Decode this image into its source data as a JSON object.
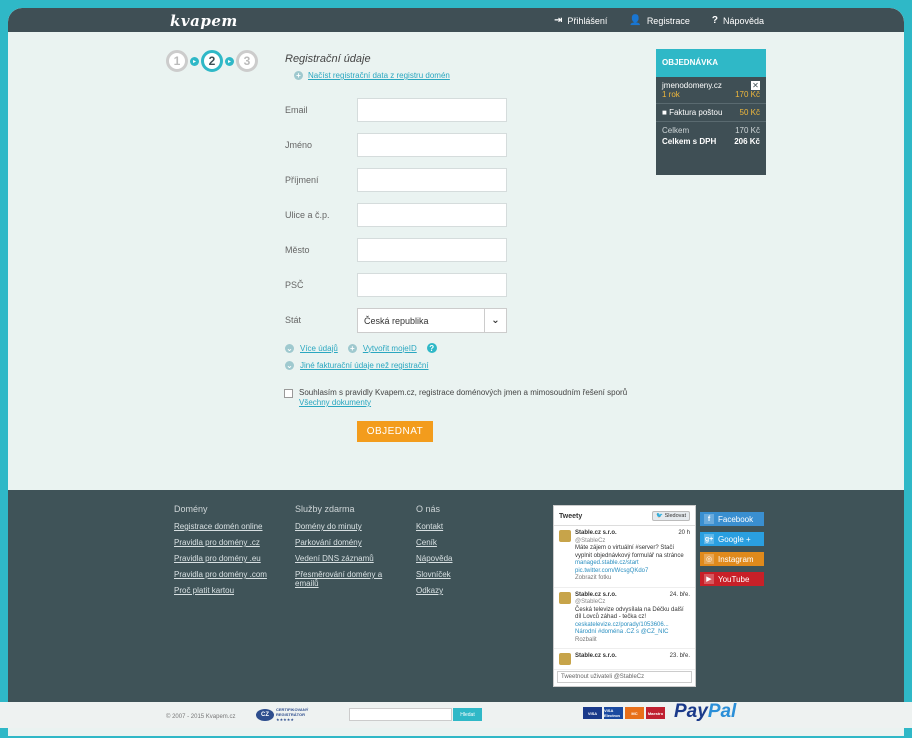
{
  "header": {
    "logo": "kvapem",
    "nav": [
      {
        "icon": "login-icon",
        "glyph": "⇥",
        "label": "Přihlášení"
      },
      {
        "icon": "user-add-icon",
        "glyph": "👤",
        "label": "Registrace"
      },
      {
        "icon": "help-icon",
        "glyph": "?",
        "label": "Nápověda"
      }
    ]
  },
  "steps": [
    "1",
    "2",
    "3"
  ],
  "active_step": 2,
  "form": {
    "title": "Registrační údaje",
    "load_link": "Načíst registrační data z registru domén",
    "fields": [
      {
        "label": "Email",
        "value": ""
      },
      {
        "label": "Jméno",
        "value": ""
      },
      {
        "label": "Příjmení",
        "value": ""
      },
      {
        "label": "Ulice a č.p.",
        "value": ""
      },
      {
        "label": "Město",
        "value": ""
      },
      {
        "label": "PSČ",
        "value": ""
      }
    ],
    "country_label": "Stát",
    "country_value": "Česká republika",
    "more_info": "Více údajů",
    "create_mojeid": "Vytvořit mojeID",
    "different_billing": "Jiné fakturační údaje než registrační",
    "agree_text": "Souhlasím s pravidly Kvapem.cz, registrace doménových jmen a mimosoudním řešení sporů",
    "all_docs": "Všechny dokumenty",
    "submit": "OBJEDNAT"
  },
  "order": {
    "title": "OBJEDNÁVKA",
    "domain": "jmenodomeny.cz",
    "period": "1 rok",
    "period_price": "170 Kč",
    "invoice_label": "Faktura poštou",
    "invoice_price": "50 Kč",
    "total_label": "Celkem",
    "total_value": "170 Kč",
    "total_vat_label": "Celkem s DPH",
    "total_vat_value": "206 Kč"
  },
  "footer": {
    "columns": [
      {
        "heading": "Domény",
        "links": [
          "Registrace domén online",
          "Pravidla pro domény .cz",
          "Pravidla pro domény .eu",
          "Pravidla pro domény .com",
          "Proč platit kartou"
        ]
      },
      {
        "heading": "Služby zdarma",
        "links": [
          "Domény do minuty",
          "Parkování domény",
          "Vedení DNS záznamů",
          "Přesměrování domény a emailů"
        ]
      },
      {
        "heading": "O nás",
        "links": [
          "Kontakt",
          "Ceník",
          "Nápověda",
          "Slovníček",
          "Odkazy"
        ]
      }
    ],
    "tweets": {
      "title": "Tweety",
      "follow": "Sledovat",
      "items": [
        {
          "author": "Stable.cz s.r.o.",
          "handle": "@StableCz",
          "time": "20 h",
          "text": "Máte zájem o virtuální #server? Stačí vyplnit objednávkový formulář na stránce",
          "link": "managed.stable.cz/start pic.twitter.com/WcsgQKdo7",
          "extra": "Zobrazit fotku"
        },
        {
          "author": "Stable.cz s.r.o.",
          "handle": "@StableCz",
          "time": "24. bře.",
          "text": "Česká televize odvysílala na Déčku další díl Lovců záhad - tečka cz!",
          "link": "ceskatelevize.cz/porady/1053606... Národní #doména .CZ s @CZ_NIC",
          "extra": "Rozbalit"
        },
        {
          "author": "Stable.cz s.r.o.",
          "handle": "",
          "time": "23. bře.",
          "text": "",
          "link": "",
          "extra": ""
        }
      ],
      "compose": "Tweetnout uživateli @StableCz"
    },
    "social": [
      {
        "label": "Facebook",
        "glyph": "f",
        "color": "#3a8fd0"
      },
      {
        "label": "Google +",
        "glyph": "g+",
        "color": "#2a9fe0"
      },
      {
        "label": "Instagram",
        "glyph": "◎",
        "color": "#e08a1c"
      },
      {
        "label": "YouTube",
        "glyph": "▶",
        "color": "#c82028"
      }
    ]
  },
  "bottom": {
    "copyright": "© 2007 - 2015 Kvapem.cz",
    "cz_badge": "CZ",
    "cz_text": "CERTIFIKOVANÝ REGISTRÁTOR ★★★★★",
    "search_button": "Hledat",
    "cards": [
      "VISA",
      "VISA Electron",
      "MC",
      "Maestro"
    ],
    "paypal_a": "Pay",
    "paypal_b": "Pal"
  }
}
